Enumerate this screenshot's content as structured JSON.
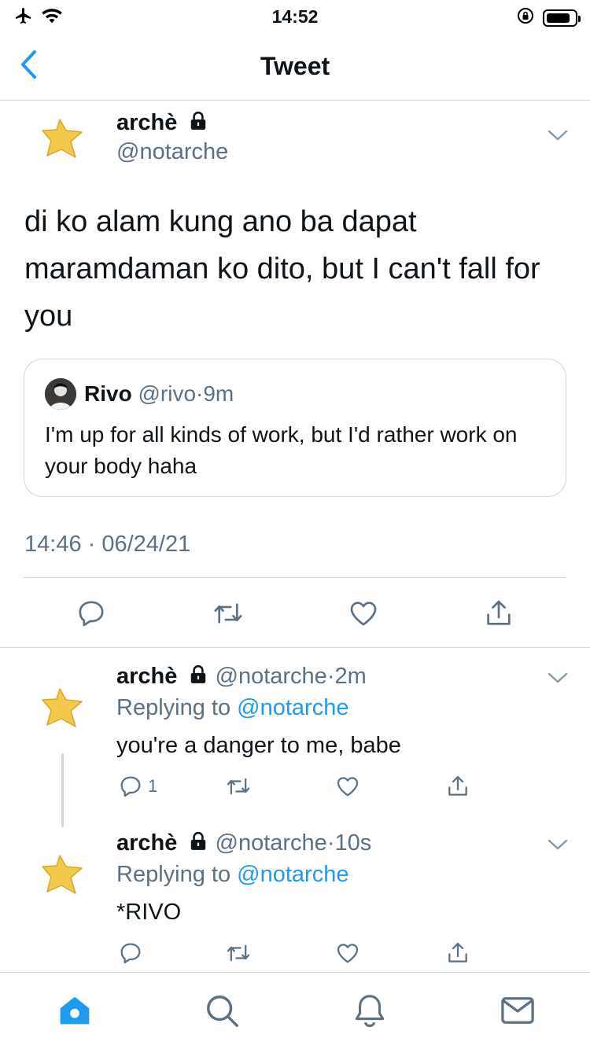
{
  "status_bar": {
    "time": "14:52"
  },
  "nav": {
    "title": "Tweet",
    "back_icon": "chevron-left-icon"
  },
  "main_tweet": {
    "author_name": "archè",
    "handle": "@notarche",
    "text": "di ko alam kung ano ba dapat maramdaman ko dito, but I can't fall for you",
    "quoted": {
      "name": "Rivo",
      "handle": "@rivo",
      "time": "9m",
      "text": "I'm up for all kinds of work, but I'd rather work on your body haha"
    },
    "timestamp": "14:46 · 06/24/21"
  },
  "replies": [
    {
      "author_name": "archè",
      "handle": "@notarche",
      "time": "2m",
      "replying_label": "Replying to",
      "replying_to": "@notarche",
      "text": "you're a danger to me, babe",
      "reply_count": "1"
    },
    {
      "author_name": "archè",
      "handle": "@notarche",
      "time": "10s",
      "replying_label": "Replying to",
      "replying_to": "@notarche",
      "text": "*RIVO",
      "reply_count": ""
    }
  ],
  "colors": {
    "accent": "#1d9bf0",
    "muted": "#5b7083",
    "star": "#f2c94c"
  },
  "status_bar_battery_level": 0.85
}
